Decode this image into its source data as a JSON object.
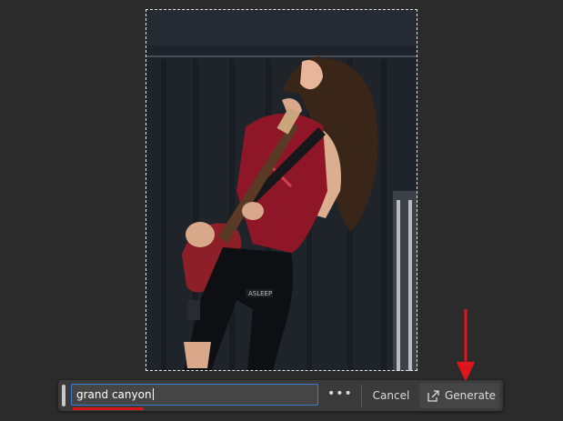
{
  "canvas": {
    "image_description_icon": "photo-guitarist-icon"
  },
  "prompt_bar": {
    "input_value": "grand canyon",
    "more_label": "•••",
    "cancel_label": "Cancel",
    "generate_label": "Generate",
    "generate_icon": "external-generate-icon"
  },
  "colors": {
    "accent_blue": "#3a7bd5",
    "annotation_red": "#d9141c",
    "toolbar_bg": "#3a3a3a"
  }
}
